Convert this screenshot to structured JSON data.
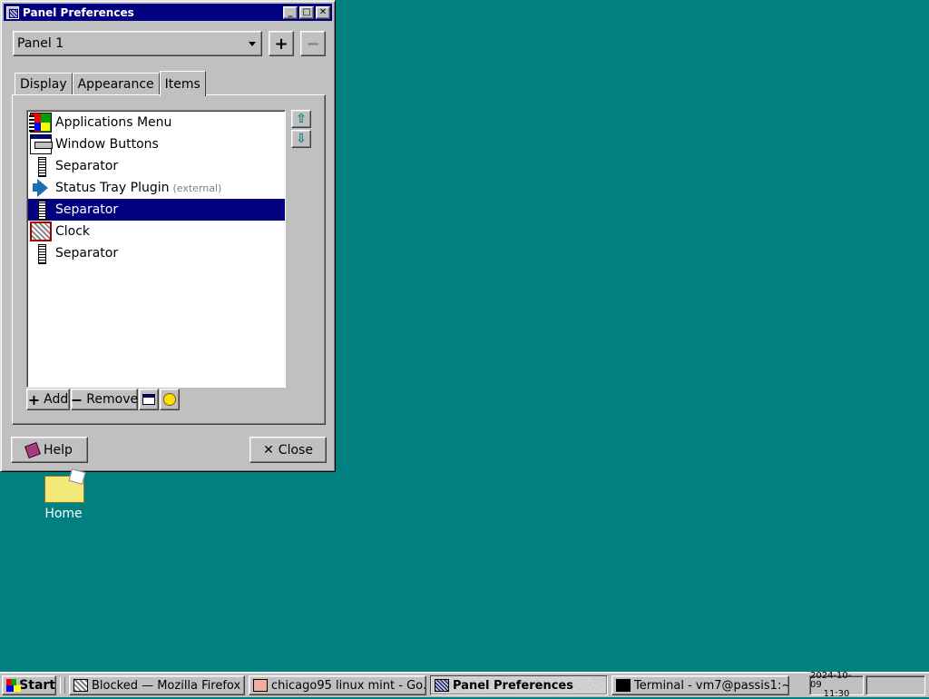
{
  "window": {
    "title": "Panel Preferences",
    "controls": {
      "minimize": "_",
      "maximize": "□",
      "close": "✕"
    }
  },
  "panel_selector": {
    "value": "Panel 1",
    "add": "+",
    "remove": "−"
  },
  "tabs": [
    {
      "label": "Display"
    },
    {
      "label": "Appearance"
    },
    {
      "label": "Items",
      "active": true
    }
  ],
  "items": [
    {
      "label": "Applications Menu",
      "icon": "applications-menu-icon"
    },
    {
      "label": "Window Buttons",
      "icon": "window-buttons-icon"
    },
    {
      "label": "Separator",
      "icon": "separator-icon"
    },
    {
      "label": "Status Tray Plugin",
      "note": "(external)",
      "icon": "status-tray-icon"
    },
    {
      "label": "Separator",
      "icon": "separator-icon",
      "selected": true
    },
    {
      "label": "Clock",
      "icon": "clock-icon"
    },
    {
      "label": "Separator",
      "icon": "separator-icon"
    }
  ],
  "move": {
    "up": "⇧",
    "down": "⇩"
  },
  "item_buttons": {
    "add": "Add",
    "remove": "Remove"
  },
  "dialog_buttons": {
    "help": "Help",
    "close": "Close"
  },
  "desktop": {
    "home_label": "Home"
  },
  "taskbar": {
    "start": "Start",
    "tasks": [
      {
        "label": "Blocked — Mozilla Firefox"
      },
      {
        "label": "chicago95 linux mint - Go..."
      },
      {
        "label": "Panel Preferences",
        "active": true
      },
      {
        "label": "Terminal - vm7@passis1:~"
      }
    ],
    "date": "2024-10-09",
    "time": "11:30"
  },
  "colors": {
    "desktop": "#008080",
    "selection": "#000080",
    "chrome": "#c0c0c0"
  }
}
